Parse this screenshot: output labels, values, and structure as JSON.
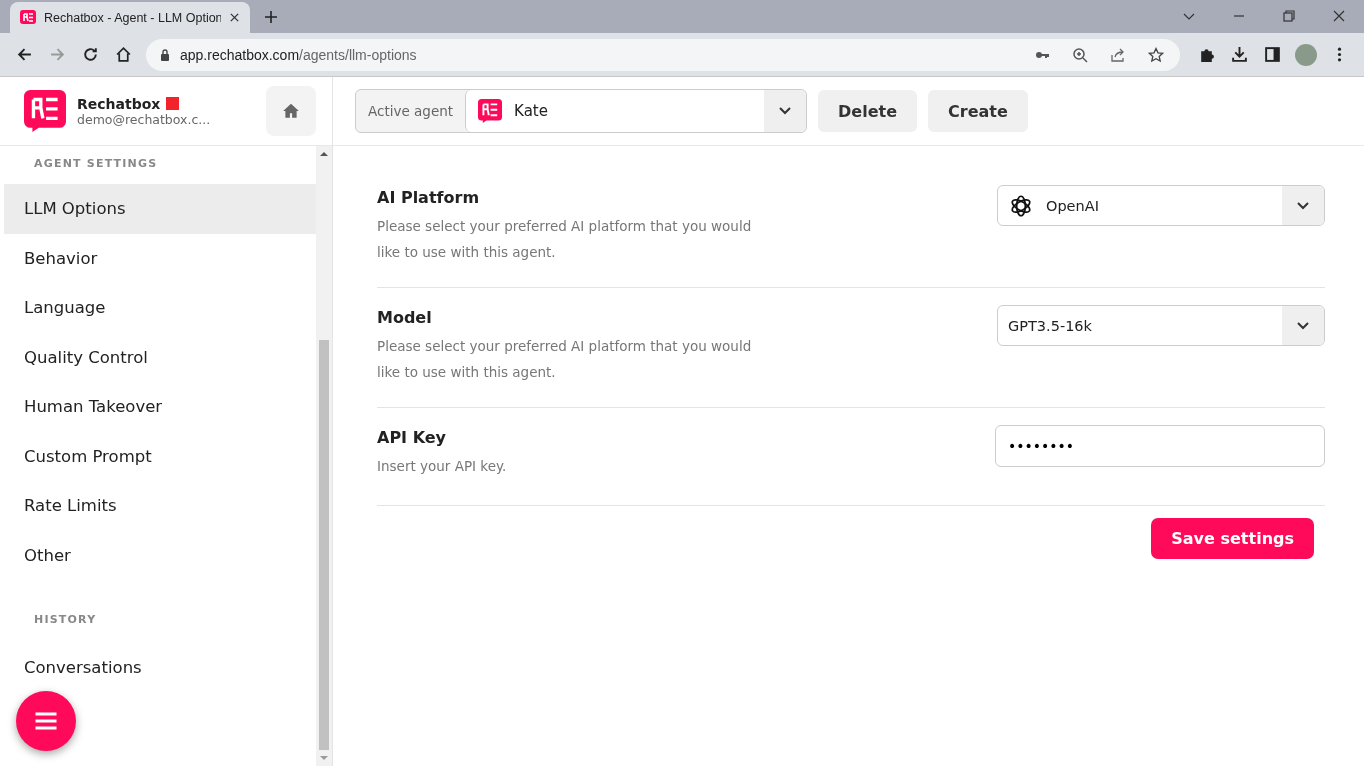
{
  "browser": {
    "tab_title": "Rechatbox - Agent - LLM Option",
    "url_host": "app.rechatbox.com",
    "url_path": "/agents/llm-options"
  },
  "brand": {
    "name": "Rechatbox",
    "email": "demo@rechatbox.c..."
  },
  "sidebar": {
    "sections": [
      {
        "heading": "AGENT SETTINGS",
        "items": [
          {
            "label": "LLM Options",
            "selected": true
          },
          {
            "label": "Behavior",
            "selected": false
          },
          {
            "label": "Language",
            "selected": false
          },
          {
            "label": "Quality Control",
            "selected": false
          },
          {
            "label": "Human Takeover",
            "selected": false
          },
          {
            "label": "Custom Prompt",
            "selected": false
          },
          {
            "label": "Rate Limits",
            "selected": false
          },
          {
            "label": "Other",
            "selected": false
          }
        ]
      },
      {
        "heading": "HISTORY",
        "items": [
          {
            "label": "Conversations",
            "selected": false
          }
        ]
      }
    ]
  },
  "topbar": {
    "agent_label": "Active agent",
    "agent_name": "Kate",
    "buttons": [
      "Delete",
      "Create"
    ]
  },
  "settings": [
    {
      "kind": "select",
      "title": "AI Platform",
      "description": "Please select your preferred AI platform that you would like to use with this agent.",
      "value": "OpenAI",
      "logo": true
    },
    {
      "kind": "select",
      "title": "Model",
      "description": "Please select your preferred AI platform that you would like to use with this agent.",
      "value": "GPT3.5-16k",
      "logo": false
    },
    {
      "kind": "input",
      "title": "API Key",
      "description": "Insert your API key.",
      "value": "••••••••"
    }
  ],
  "save_button": "Save settings"
}
